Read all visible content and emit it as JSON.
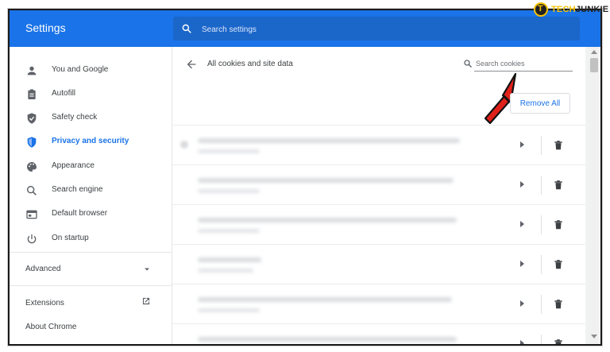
{
  "header": {
    "title": "Settings",
    "search_placeholder": "Search settings"
  },
  "watermark": {
    "part1": "TECH",
    "part2": "JUNKIE",
    "logo_letter": "T"
  },
  "sidebar": {
    "items": [
      {
        "label": "You and Google",
        "icon": "person-icon"
      },
      {
        "label": "Autofill",
        "icon": "clipboard-icon"
      },
      {
        "label": "Safety check",
        "icon": "shield-check-icon"
      },
      {
        "label": "Privacy and security",
        "icon": "shield-icon",
        "active": true
      },
      {
        "label": "Appearance",
        "icon": "palette-icon"
      },
      {
        "label": "Search engine",
        "icon": "search-icon"
      },
      {
        "label": "Default browser",
        "icon": "browser-icon"
      },
      {
        "label": "On startup",
        "icon": "power-icon"
      }
    ],
    "advanced_label": "Advanced",
    "extensions_label": "Extensions",
    "about_label": "About Chrome"
  },
  "main": {
    "title": "All cookies and site data",
    "cookie_search_placeholder": "Search cookies",
    "remove_all_label": "Remove All",
    "rows_note": "site entries are blurred in the screenshot",
    "row_count": 6
  },
  "colors": {
    "accent": "#1a73e8",
    "annotation_arrow": "#e0211a"
  }
}
